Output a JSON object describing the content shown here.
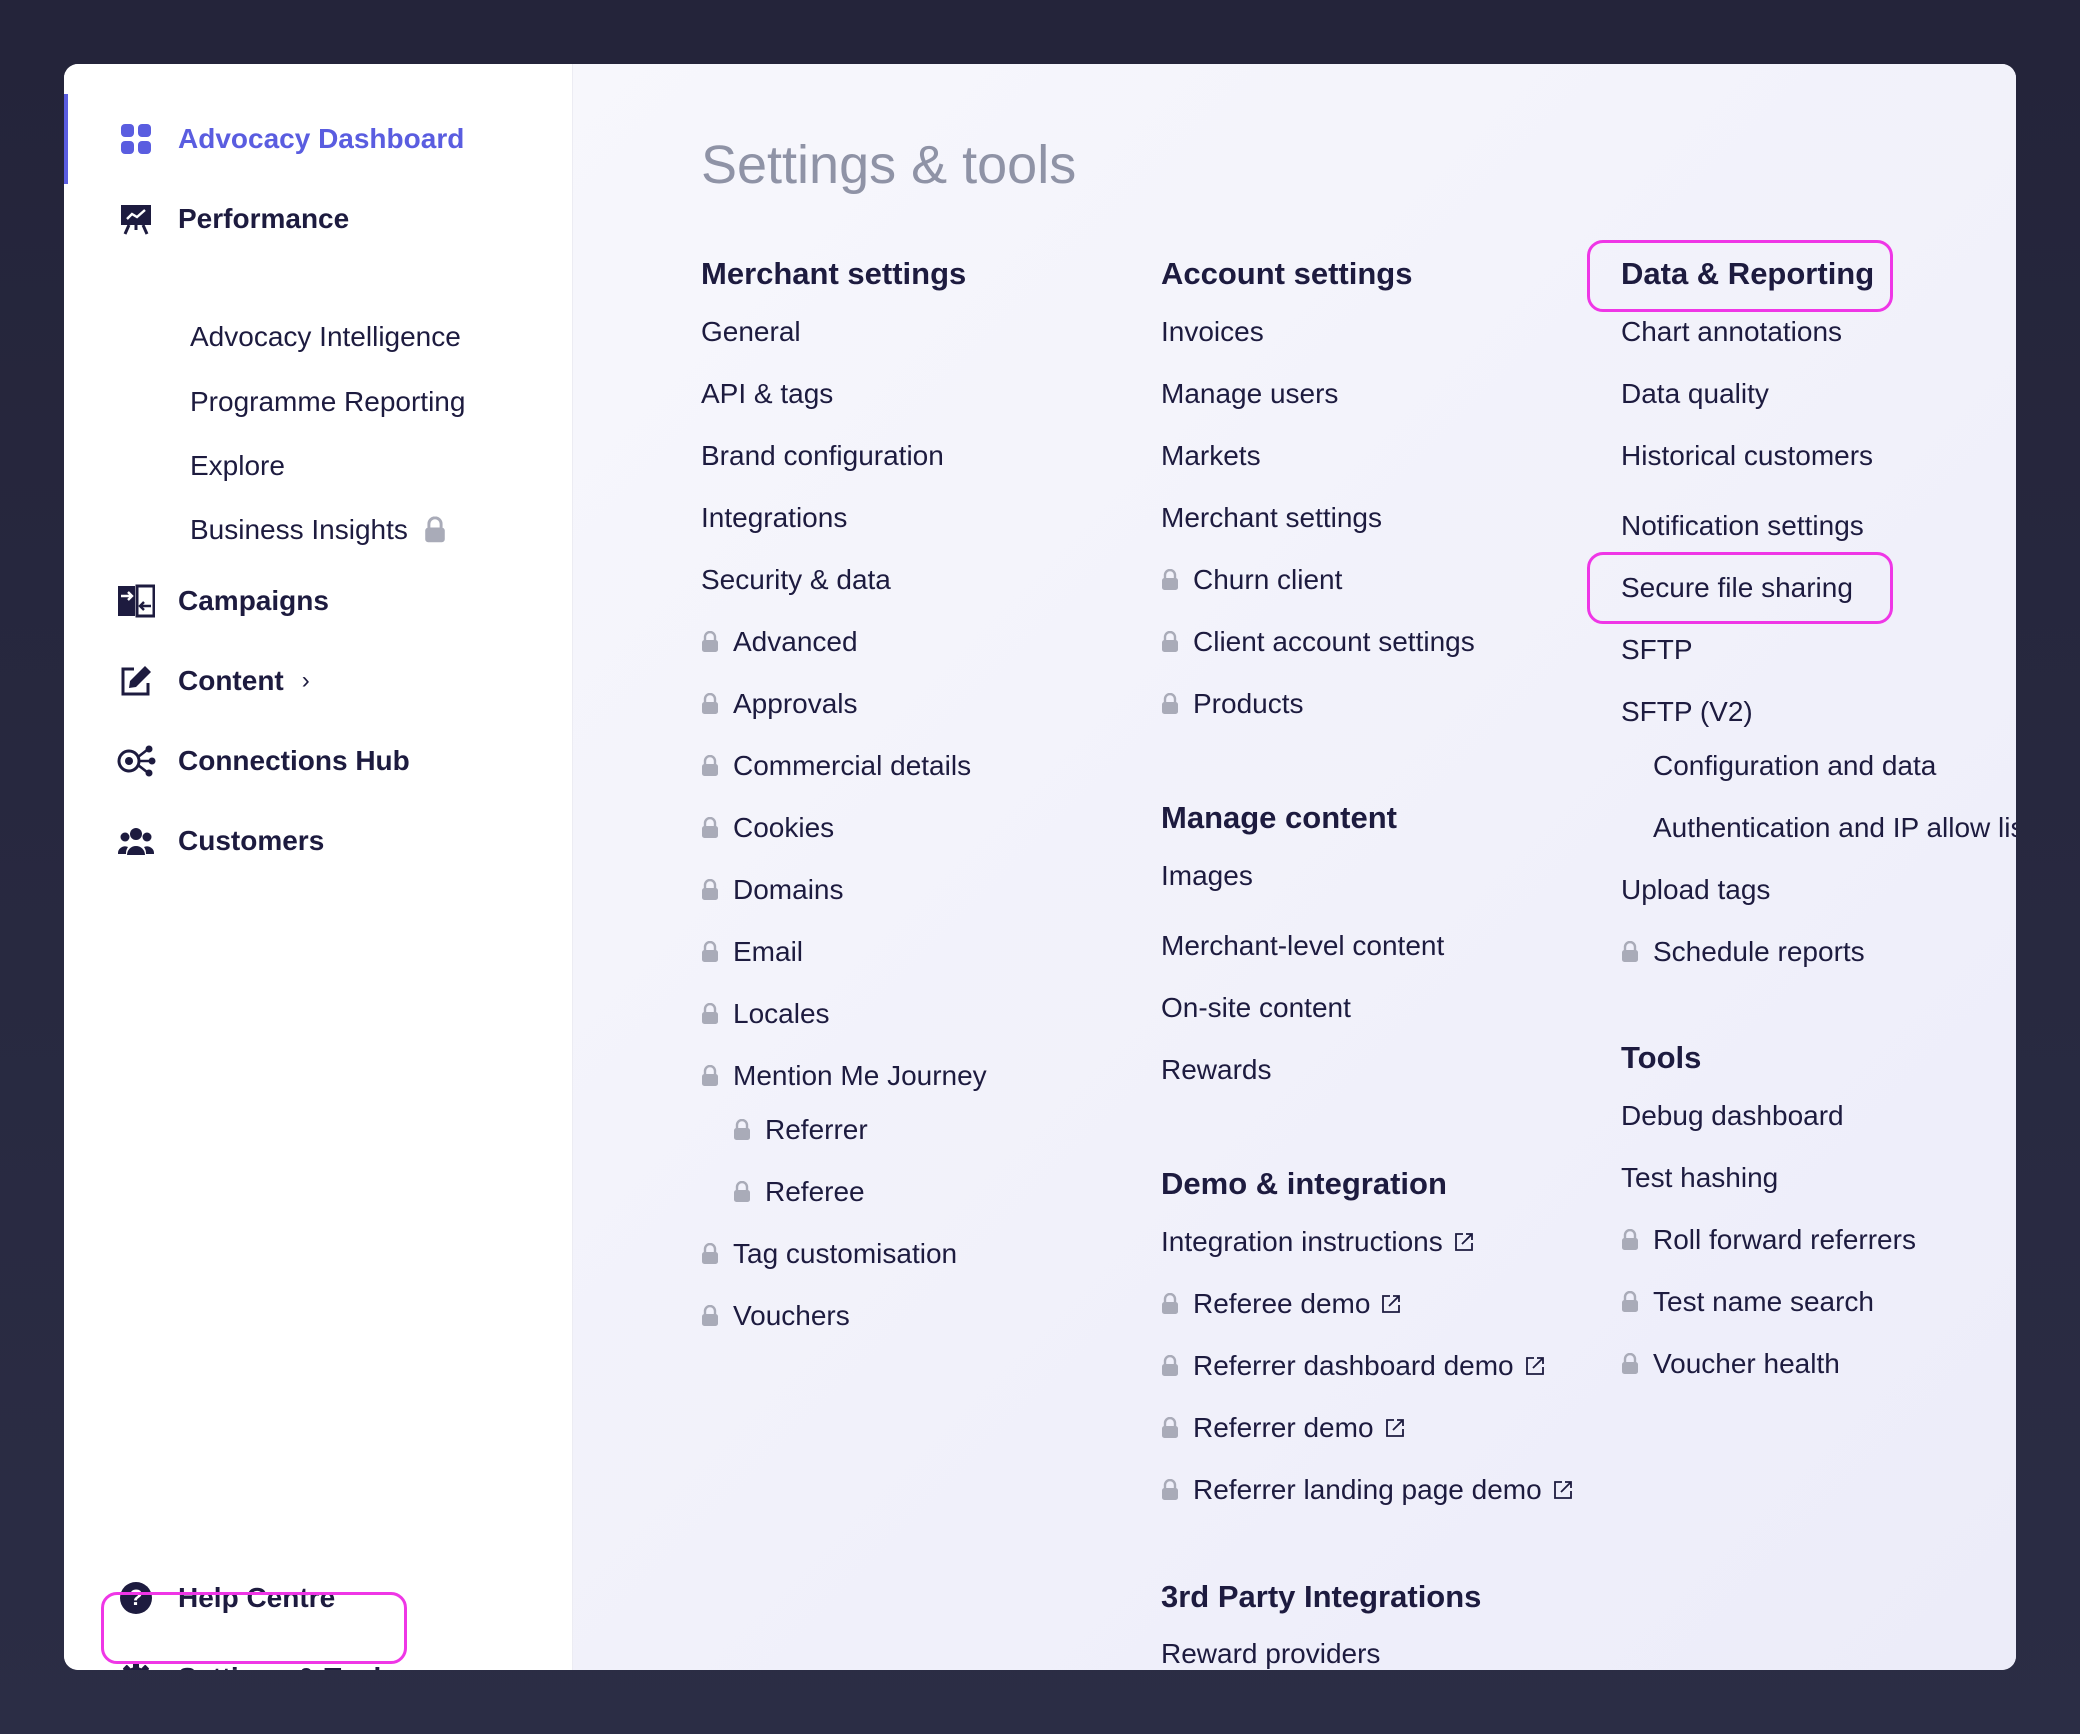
{
  "sidebar": {
    "items": [
      {
        "label": "Advocacy Dashboard",
        "icon": "grid-icon"
      },
      {
        "label": "Performance",
        "icon": "presentation-chart-icon"
      },
      {
        "label": "Campaigns",
        "icon": "campaign-arrows-icon"
      },
      {
        "label": "Content",
        "icon": "edit-icon"
      },
      {
        "label": "Connections Hub",
        "icon": "connections-icon"
      },
      {
        "label": "Customers",
        "icon": "users-icon"
      }
    ],
    "performance_sub": [
      "Advocacy Intelligence",
      "Programme Reporting",
      "Explore",
      "Business Insights"
    ],
    "help": "Help Centre",
    "settings": "Settings & Tools"
  },
  "main": {
    "title": "Settings & tools",
    "merchant": {
      "heading": "Merchant settings",
      "items": [
        "General",
        "API & tags",
        "Brand configuration",
        "Integrations",
        "Security & data",
        "Advanced",
        "Approvals",
        "Commercial details",
        "Cookies",
        "Domains",
        "Email",
        "Locales",
        "Mention Me Journey",
        "Referrer",
        "Referee",
        "Tag customisation",
        "Vouchers"
      ]
    },
    "account": {
      "heading": "Account settings",
      "items": [
        "Invoices",
        "Manage users",
        "Markets",
        "Merchant settings",
        "Churn client",
        "Client account settings",
        "Products"
      ]
    },
    "manage_content": {
      "heading": "Manage content",
      "items": [
        "Images",
        "Merchant-level content",
        "On-site content",
        "Rewards"
      ]
    },
    "demo": {
      "heading": "Demo & integration",
      "items": [
        "Integration instructions",
        "Referee demo",
        "Referrer dashboard demo",
        "Referrer demo",
        "Referrer landing page demo"
      ]
    },
    "third_party": {
      "heading": "3rd Party Integrations",
      "items": [
        "Reward providers"
      ]
    },
    "data_reporting": {
      "heading": "Data & Reporting",
      "items": [
        "Chart annotations",
        "Data quality",
        "Historical customers",
        "Notification settings",
        "Secure file sharing",
        "SFTP",
        "SFTP (V2)",
        "Configuration and data",
        "Authentication and IP allow list",
        "Upload tags",
        "Schedule reports"
      ]
    },
    "tools": {
      "heading": "Tools",
      "items": [
        "Debug dashboard",
        "Test hashing",
        "Roll forward referrers",
        "Test name search",
        "Voucher health"
      ]
    }
  },
  "colors": {
    "accent": "#5a5de0",
    "highlight": "#ef36e6",
    "text": "#1d1b3f",
    "muted": "#8f93a6",
    "lock": "#a9abb8"
  }
}
